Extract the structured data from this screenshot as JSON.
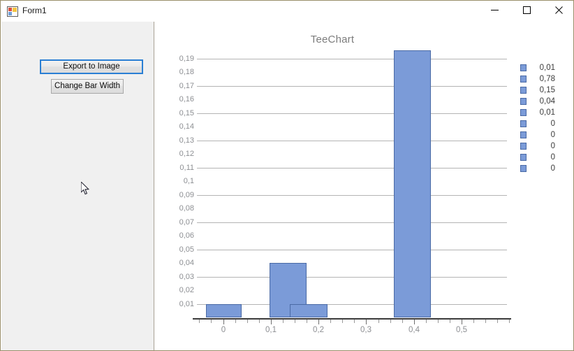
{
  "window": {
    "title": "Form1",
    "icon": "form-icon",
    "controls": {
      "minimize": "─",
      "maximize": "☐",
      "close": "✕"
    }
  },
  "left_panel": {
    "export_button": "Export to Image",
    "bar_width_button": "Change Bar Width"
  },
  "chart_data": {
    "type": "bar",
    "title": "TeeChart",
    "xlabel": "",
    "ylabel": "",
    "grid": true,
    "legend_position": "right",
    "xlim": [
      -0.055,
      0.595
    ],
    "ylim": [
      0,
      0.1985
    ],
    "x_ticks": [
      "0",
      "0,1",
      "0,2",
      "0,3",
      "0,4",
      "0,5"
    ],
    "x_tick_values": [
      0,
      0.1,
      0.2,
      0.3,
      0.4,
      0.5
    ],
    "y_ticks": [
      "0,19",
      "0,18",
      "0,17",
      "0,16",
      "0,15",
      "0,14",
      "0,13",
      "0,12",
      "0,11",
      "0,1",
      "0,09",
      "0,08",
      "0,07",
      "0,06",
      "0,05",
      "0,04",
      "0,03",
      "0,02",
      "0,01"
    ],
    "y_tick_values": [
      0.19,
      0.18,
      0.17,
      0.16,
      0.15,
      0.14,
      0.13,
      0.12,
      0.11,
      0.1,
      0.09,
      0.08,
      0.07,
      0.06,
      0.05,
      0.04,
      0.03,
      0.02,
      0.01
    ],
    "gridline_values": [
      0.19,
      0.17,
      0.15,
      0.13,
      0.11,
      0.09,
      0.07,
      0.05,
      0.03,
      0.01
    ],
    "bar_color": "#7b9bd8",
    "bar_border_color": "#4a6aa5",
    "bars": [
      {
        "x_start": -0.0355,
        "x_end": 0.0385,
        "value": 0.01
      },
      {
        "x_start": 0.0975,
        "x_end": 0.1755,
        "value": 0.04
      },
      {
        "x_start": 0.1395,
        "x_end": 0.2185,
        "value": 0.01
      },
      {
        "x_start": 0.3575,
        "x_end": 0.4355,
        "value": 0.196
      }
    ],
    "legend_entries": [
      "0,01",
      "0,78",
      "0,15",
      "0,04",
      "0,01",
      "0",
      "0",
      "0",
      "0",
      "0"
    ]
  }
}
